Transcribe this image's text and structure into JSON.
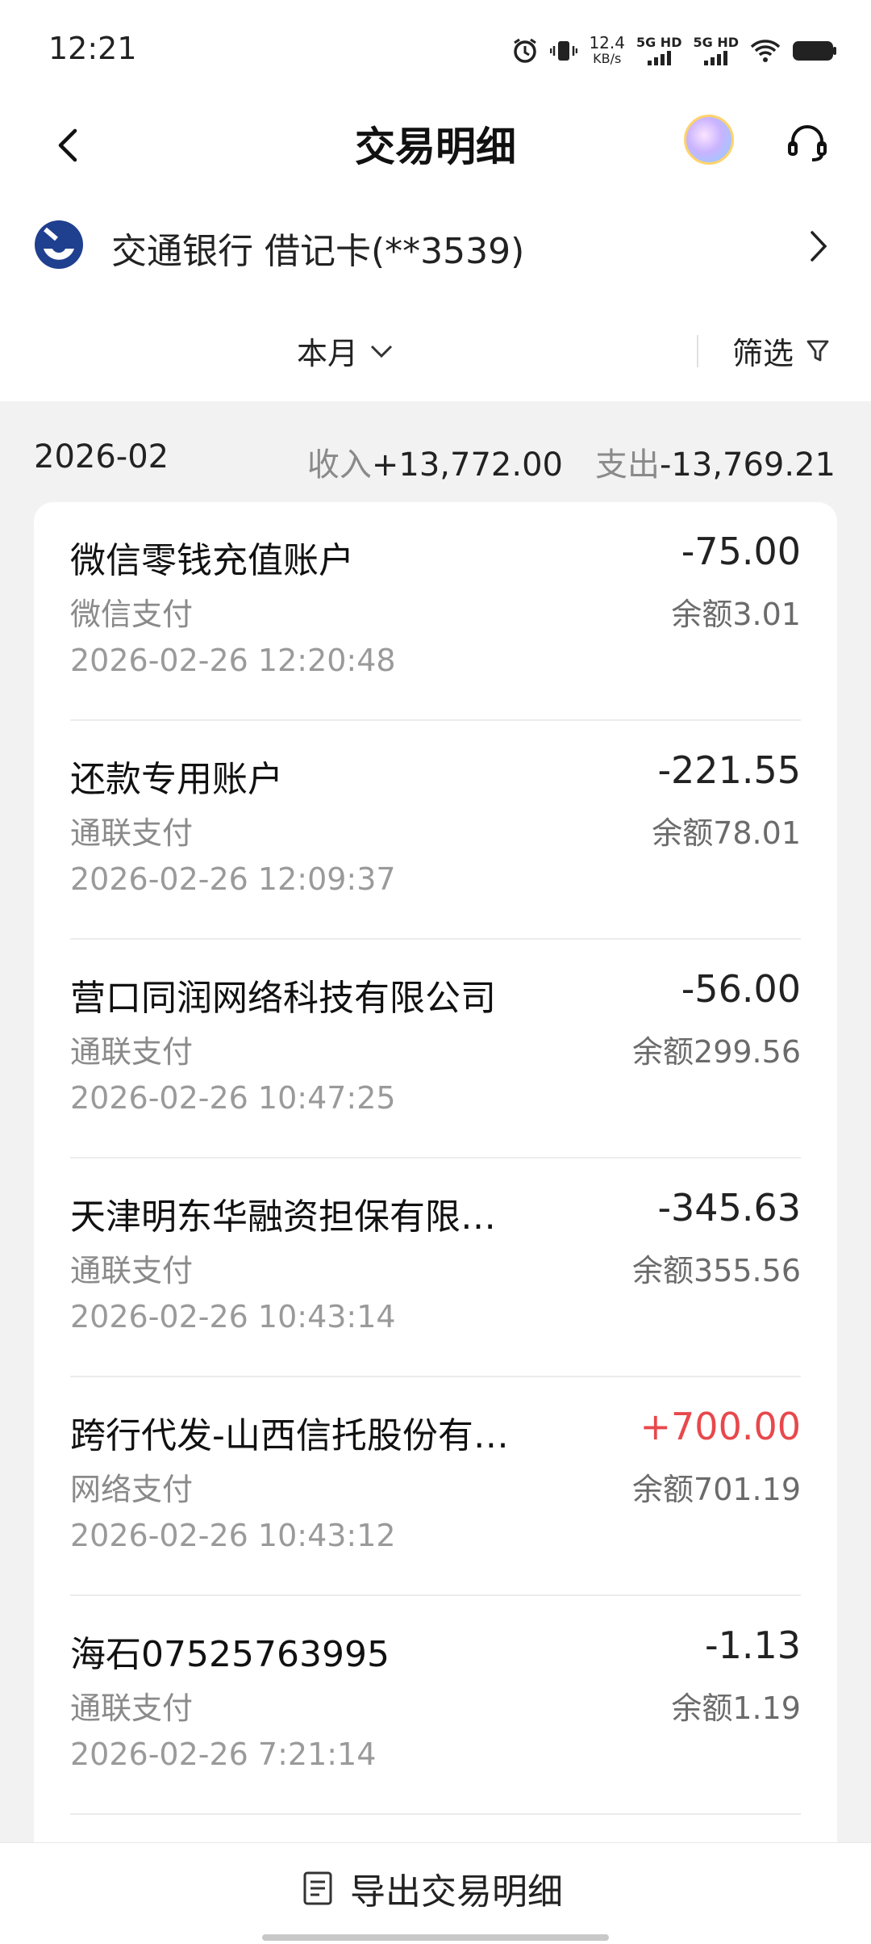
{
  "status_bar": {
    "time": "12:21",
    "speed_value": "12.4",
    "speed_unit": "KB/s",
    "signal1_label": "5G HD",
    "signal2_label": "5G HD"
  },
  "header": {
    "title": "交易明细",
    "back_icon": "chevron-left-icon",
    "service_icon": "headset-icon"
  },
  "account": {
    "name": "交通银行 借记卡(**3539)"
  },
  "filters": {
    "month": "本月",
    "filter_label": "筛选"
  },
  "summary": {
    "month": "2026-02",
    "income_label": "收入",
    "income_value": "+13,772.00",
    "expense_label": "支出",
    "expense_value": "-13,769.21"
  },
  "transactions": [
    {
      "name": "微信零钱充值账户",
      "amount": "-75.00",
      "method": "微信支付",
      "balance": "余额3.01",
      "time": "2026-02-26 12:20:48",
      "type": "expense"
    },
    {
      "name": "还款专用账户",
      "amount": "-221.55",
      "method": "通联支付",
      "balance": "余额78.01",
      "time": "2026-02-26 12:09:37",
      "type": "expense"
    },
    {
      "name": "营口同润网络科技有限公司",
      "amount": "-56.00",
      "method": "通联支付",
      "balance": "余额299.56",
      "time": "2026-02-26 10:47:25",
      "type": "expense"
    },
    {
      "name": "天津明东华融资担保有限…",
      "amount": "-345.63",
      "method": "通联支付",
      "balance": "余额355.56",
      "time": "2026-02-26 10:43:14",
      "type": "expense"
    },
    {
      "name": "跨行代发-山西信托股份有…",
      "amount": "+700.00",
      "method": "网络支付",
      "balance": "余额701.19",
      "time": "2026-02-26 10:43:12",
      "type": "income"
    },
    {
      "name": "海石07525763995",
      "amount": "-1.13",
      "method": "通联支付",
      "balance": "余额1.19",
      "time": "2026-02-26 7:21:14",
      "type": "expense"
    }
  ],
  "bottom": {
    "export_label": "导出交易明细"
  },
  "colors": {
    "income": "#e8484c",
    "muted": "#8a8a8a",
    "background": "#f2f2f2"
  }
}
